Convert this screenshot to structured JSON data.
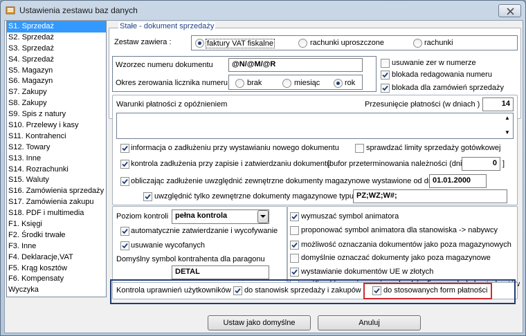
{
  "window": {
    "title": "Ustawienia zestawu baz danych"
  },
  "sidebar": {
    "items": [
      "S1. Sprzedaż",
      "S2. Sprzedaż",
      "S3. Sprzedaż",
      "S4. Sprzedaż",
      "S5. Magazyn",
      "S6. Magazyn",
      "S7. Zakupy",
      "S8. Zakupy",
      "S9. Spis z natury",
      "S10. Przelewy i kasy",
      "S11. Kontrahenci",
      "S12. Towary",
      "S13. Inne",
      "S14. Rozrachunki",
      "S15. Waluty",
      "S16. Zamówienia sprzedaży",
      "S17. Zamówienia zakupu",
      "S18. PDF i multimedia",
      "F1. Księgi",
      "F2. Środki trwałe",
      "F3. Inne",
      "F4. Deklaracje,VAT",
      "F5. Krąg kosztów",
      "F6. Kompensaty",
      "Wyczyka"
    ],
    "selected_index": 0
  },
  "section_doc": {
    "legend": "Stałe - dokument sprzedaży",
    "zestaw_label": "Zestaw zawiera :",
    "zestaw_options": [
      "faktury VAT fiskalne",
      "rachunki uproszczone",
      "rachunki"
    ],
    "zestaw_selected": 0,
    "wzorzec_label": "Wzorzec numeru dokumentu",
    "wzorzec_value": "@N/@M/@R",
    "okres_label": "Okres zerowania licznika numeru",
    "okres_options": [
      "brak",
      "miesiąc",
      "rok"
    ],
    "okres_selected": 2,
    "usuwanie_zer": "usuwanie zer w numerze",
    "blokada_red": "blokada redagowania numeru",
    "blokada_zam": "blokada dla zamówień sprzedaży"
  },
  "payment": {
    "warunki_label": "Warunki płatności z opóźnieniem",
    "przesuniecie_label": "Przesunięcie płatności (w dniach )",
    "przesuniecie_value": "14",
    "info_label": "informacja o zadłużeniu przy wystawianiu nowego dokumentu",
    "limity_label": "sprawdzać limity sprzedaży gotówkowej",
    "kontrola_label": "kontrola zadłużenia przy zapisie i zatwierdzaniu dokumentu",
    "bufor_label": "[bufor przeterminowania należności (dni)",
    "bufor_value": "0",
    "bufor_close": "]",
    "obliczajac_label": "obliczając zadłużenie uwzględnić zewnętrzne dokumenty magazynowe wystawione od dnia",
    "date_value": "01.01.2000",
    "typu_label": "uwzględnić tylko zewnętrzne dokumenty magazynowe typu :",
    "typu_value": "PZ;WZ;W#;"
  },
  "lower": {
    "poziom_label": "Poziom kontroli",
    "poziom_value": "pełna kontrola",
    "auto_label": "automatycznie zatwierdzanie i wycofywanie",
    "usuwanie_label": "usuwanie wycofanych",
    "symbol_label": "Domyślny symbol kontrahenta dla paragonu",
    "symbol_value": "DETAL",
    "right_checks": [
      {
        "label": "wymuszać symbol animatora",
        "checked": true
      },
      {
        "label": "proponować symbol animatora dla stanowiska -> nabywcy",
        "checked": false
      },
      {
        "label": "możliwość oznaczania dokumentów jako poza magazynowych",
        "checked": true
      },
      {
        "label": "domyślnie oznaczać dokumenty jako poza magazynowe",
        "checked": false
      },
      {
        "label": "wystawianie dokumentów UE w złotych",
        "checked": true
      },
      {
        "label": "możliwość przypisywania rachunków firmowych do kontrahentów",
        "checked": true
      }
    ],
    "kontrola_upr_label": "Kontrola uprawnień użytkowników",
    "do_stanowisk_label": "do stanowisk sprzedaży i zakupów",
    "do_form_label": "do stosowanych form płatności"
  },
  "buttons": {
    "default": "Ustaw jako domyślne",
    "cancel": "Anuluj"
  },
  "colors": {
    "selection": "#3399ff",
    "blue_box": "#1f3b73",
    "red_box": "#d0282d",
    "legend": "#1c3f86"
  }
}
